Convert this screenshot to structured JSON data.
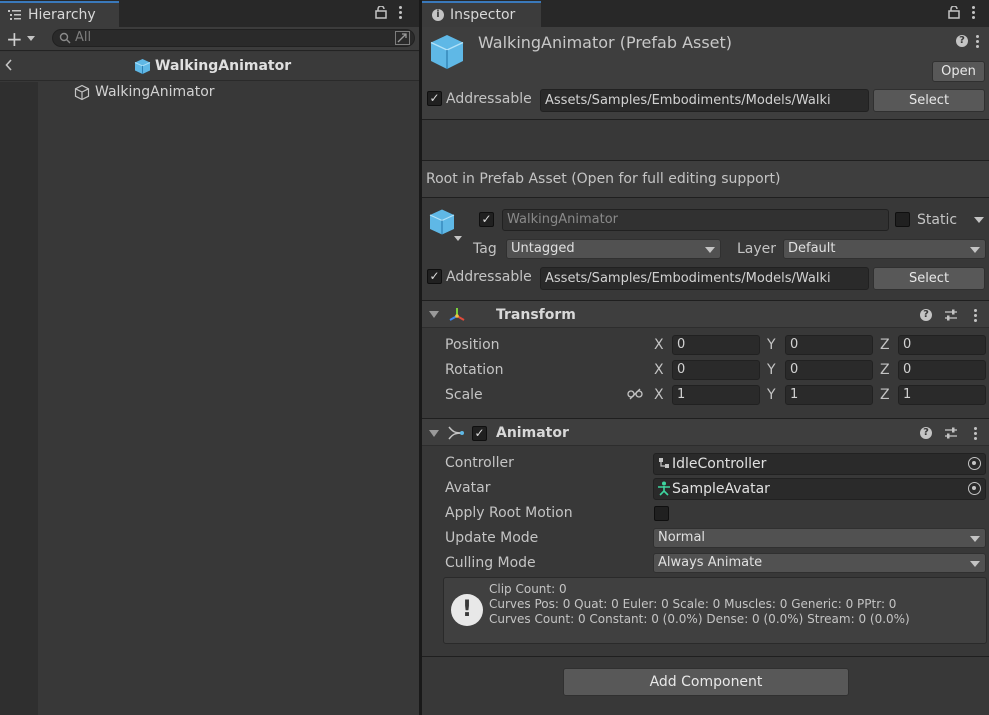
{
  "hierarchy": {
    "tab_label": "Hierarchy",
    "search_placeholder": "All",
    "breadcrumb_title": "WalkingAnimator",
    "items": [
      {
        "label": "WalkingAnimator"
      }
    ]
  },
  "inspector": {
    "tab_label": "Inspector",
    "asset_title": "WalkingAnimator (Prefab Asset)",
    "open_label": "Open",
    "addressable_label": "Addressable",
    "addressable_path": "Assets/Samples/Embodiments/Models/Walki",
    "select_label": "Select",
    "root_note": "Root in Prefab Asset (Open for full editing support)",
    "go_name": "WalkingAnimator",
    "static_label": "Static",
    "tag_label": "Tag",
    "tag_value": "Untagged",
    "layer_label": "Layer",
    "layer_value": "Default",
    "add_component_label": "Add Component"
  },
  "transform": {
    "title": "Transform",
    "rows": [
      {
        "label": "Position",
        "x": "0",
        "y": "0",
        "z": "0"
      },
      {
        "label": "Rotation",
        "x": "0",
        "y": "0",
        "z": "0"
      },
      {
        "label": "Scale",
        "x": "1",
        "y": "1",
        "z": "1"
      }
    ],
    "axis": {
      "x": "X",
      "y": "Y",
      "z": "Z"
    }
  },
  "animator": {
    "title": "Animator",
    "controller_label": "Controller",
    "controller_value": "IdleController",
    "avatar_label": "Avatar",
    "avatar_value": "SampleAvatar",
    "apply_root_motion_label": "Apply Root Motion",
    "update_mode_label": "Update Mode",
    "update_mode_value": "Normal",
    "culling_mode_label": "Culling Mode",
    "culling_mode_value": "Always Animate",
    "info_lines": [
      "Clip Count: 0",
      "Curves Pos: 0 Quat: 0 Euler: 0 Scale: 0 Muscles: 0 Generic: 0 PPtr: 0",
      "Curves Count: 0 Constant: 0 (0.0%) Dense: 0 (0.0%) Stream: 0 (0.0%)"
    ]
  },
  "colors": {
    "panel_bg": "#383838",
    "header_bg": "#282828",
    "accent_cube": "#6fc7f0",
    "component_header": "#3e3e3e"
  }
}
